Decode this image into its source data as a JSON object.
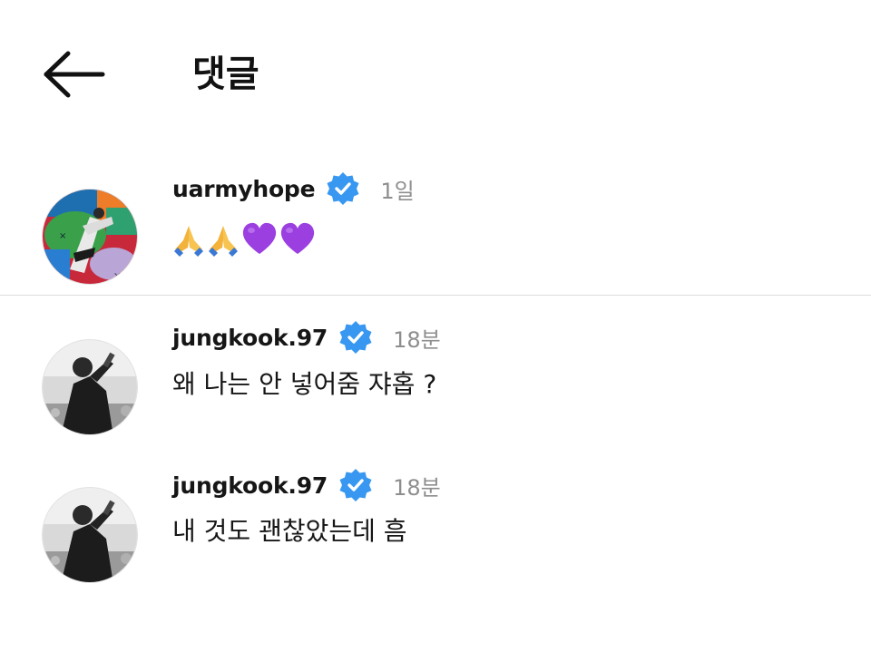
{
  "header": {
    "back_icon": "arrow-left-icon",
    "title": "댓글"
  },
  "comments": [
    {
      "username": "uarmyhope",
      "verified_icon": "verified-badge-icon",
      "time": "1일",
      "text": "",
      "emojis": [
        "folded-hands-icon",
        "folded-hands-icon",
        "purple-heart-icon",
        "purple-heart-icon"
      ]
    },
    {
      "username": "jungkook.97",
      "verified_icon": "verified-badge-icon",
      "time": "18분",
      "text": "왜 나는 안 넣어줌 쟈홉 ?"
    },
    {
      "username": "jungkook.97",
      "verified_icon": "verified-badge-icon",
      "time": "18분",
      "text": "내 것도 괜찮았는데 흠"
    }
  ],
  "colors": {
    "verified": "#3897f0",
    "purple_heart": "#9b3fe0",
    "time": "#8e8e8e",
    "divider": "#dcdcdc"
  }
}
